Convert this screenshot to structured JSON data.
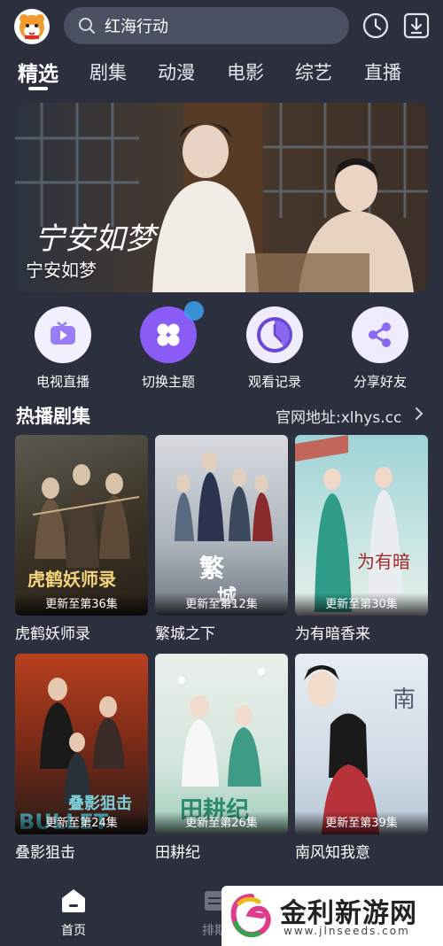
{
  "search": {
    "query": "红海行动"
  },
  "tabs": [
    {
      "label": "精选",
      "active": true
    },
    {
      "label": "剧集"
    },
    {
      "label": "动漫"
    },
    {
      "label": "电影"
    },
    {
      "label": "综艺"
    },
    {
      "label": "直播"
    }
  ],
  "banner": {
    "title": "宁安如梦"
  },
  "quick_entries": [
    {
      "label": "电视直播",
      "icon": "tv-play-icon",
      "color": "#8f7cff"
    },
    {
      "label": "切换主题",
      "icon": "theme-clover-icon",
      "color": "#7a5cff"
    },
    {
      "label": "观看记录",
      "icon": "history-clock-icon",
      "color": "#6a4de8"
    },
    {
      "label": "分享好友",
      "icon": "share-icon",
      "color": "#7a5cff"
    }
  ],
  "section": {
    "title": "热播剧集",
    "link": "官网地址:xlhys.cc"
  },
  "cards": [
    {
      "title": "虎鹤妖师录",
      "update": "更新至第36集"
    },
    {
      "title": "繁城之下",
      "update": "更新至第12集"
    },
    {
      "title": "为有暗香来",
      "update": "更新至第30集"
    },
    {
      "title": "叠影狙击",
      "update": "更新至第24集"
    },
    {
      "title": "田耕纪",
      "update": "更新至第26集"
    },
    {
      "title": "南风知我意",
      "update": "更新至第39集"
    }
  ],
  "bottom_nav": [
    {
      "label": "首页",
      "active": true
    },
    {
      "label": "排期"
    }
  ],
  "watermark": {
    "text": "金利新游网",
    "url": "www.jlnseeds.com"
  }
}
